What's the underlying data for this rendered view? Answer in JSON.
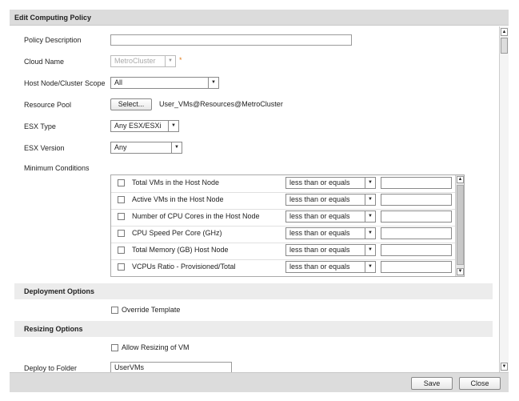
{
  "dialog": {
    "title": "Edit Computing Policy"
  },
  "form": {
    "policy_description": {
      "label": "Policy Description",
      "value": ""
    },
    "cloud_name": {
      "label": "Cloud Name",
      "value": "MetroCluster",
      "required_mark": "*"
    },
    "host_scope": {
      "label": "Host Node/Cluster Scope",
      "value": "All"
    },
    "resource_pool": {
      "label": "Resource Pool",
      "button": "Select...",
      "value": "User_VMs@Resources@MetroCluster"
    },
    "esx_type": {
      "label": "ESX Type",
      "value": "Any ESX/ESXi"
    },
    "esx_version": {
      "label": "ESX Version",
      "value": "Any"
    },
    "minimum_conditions": {
      "label": "Minimum Conditions",
      "rows": [
        {
          "name": "Total VMs in the Host Node",
          "operator": "less than or equals",
          "value": ""
        },
        {
          "name": "Active VMs in the Host Node",
          "operator": "less than or equals",
          "value": ""
        },
        {
          "name": "Number of CPU Cores in the Host Node",
          "operator": "less than or equals",
          "value": ""
        },
        {
          "name": "CPU Speed Per Core (GHz)",
          "operator": "less than or equals",
          "value": ""
        },
        {
          "name": "Total Memory (GB) Host Node",
          "operator": "less than or equals",
          "value": ""
        },
        {
          "name": "VCPUs Ratio - Provisioned/Total",
          "operator": "less than or equals",
          "value": ""
        }
      ]
    },
    "deployment": {
      "header": "Deployment Options",
      "override_label": "Override Template"
    },
    "resizing": {
      "header": "Resizing Options",
      "allow_label": "Allow Resizing of VM"
    },
    "deploy_folder": {
      "label": "Deploy to Folder",
      "value": "UserVMs"
    }
  },
  "footer": {
    "save": "Save",
    "close": "Close"
  },
  "icons": {
    "dropdown": "chevron-down-icon",
    "scroll_up": "arrow-up-icon",
    "scroll_down": "arrow-down-icon"
  },
  "colors": {
    "required": "#e07b1a",
    "titlebar": "#dcdcdc",
    "section": "#ececec"
  }
}
